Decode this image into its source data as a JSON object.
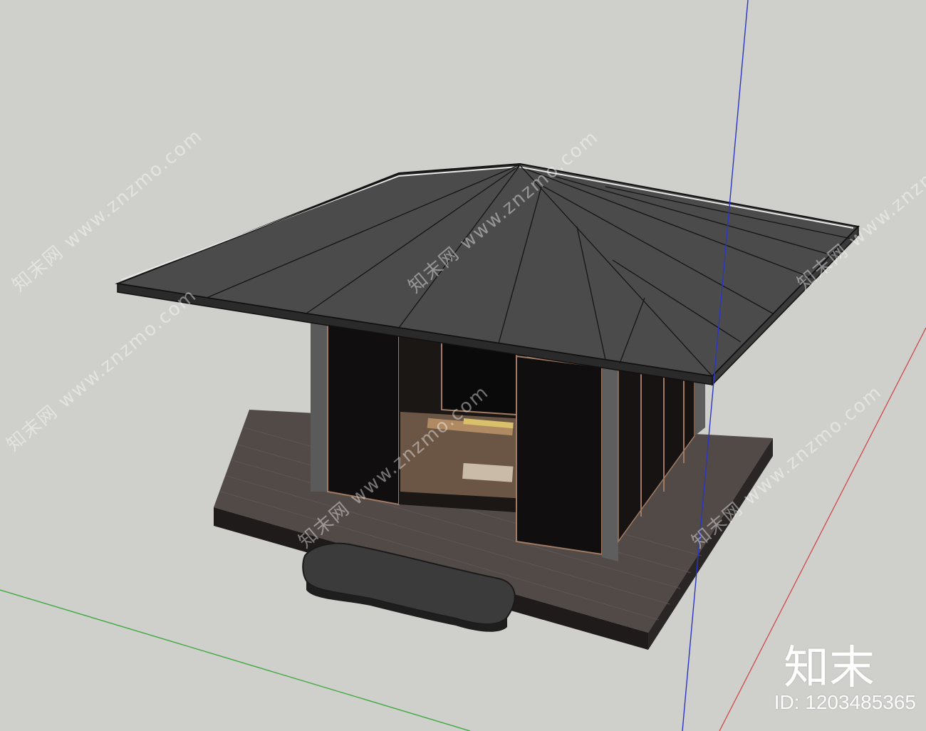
{
  "watermark": {
    "site": "知末网 www.znzmo.com",
    "brand": "知末",
    "asset_id": "ID: 1203485365"
  },
  "colors": {
    "background": "#cfcfcb",
    "roof": "#4a4a4a",
    "wall": "#121010",
    "deck": "#4f4744",
    "axis_blue": "#2b35c8",
    "axis_red": "#d04040",
    "axis_green": "#3faa3f"
  }
}
